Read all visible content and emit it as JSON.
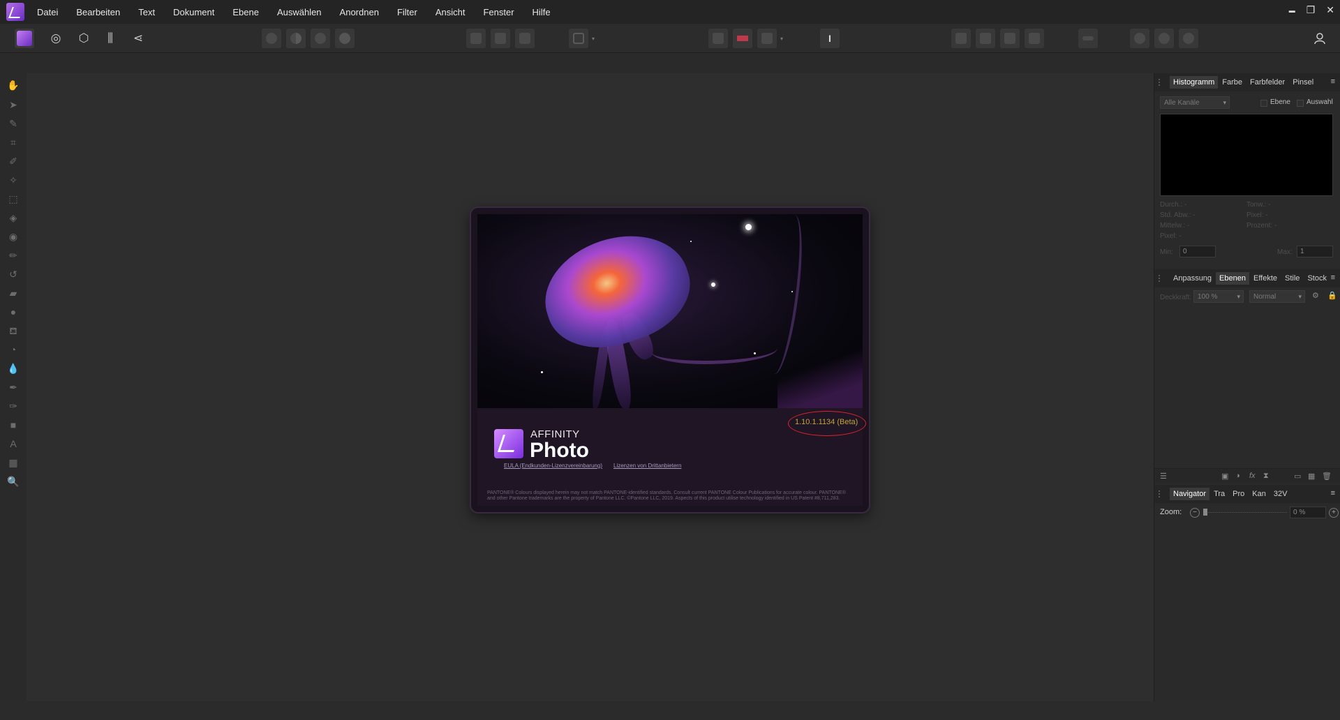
{
  "menu": {
    "items": [
      "Datei",
      "Bearbeiten",
      "Text",
      "Dokument",
      "Ebene",
      "Auswählen",
      "Anordnen",
      "Filter",
      "Ansicht",
      "Fenster",
      "Hilfe"
    ]
  },
  "window_controls": {
    "minimize": "▬",
    "restore": "❐",
    "close": "✕"
  },
  "splash": {
    "brand": "AFFINITY",
    "product": "Photo",
    "version": "1.10.1.1134 (Beta)",
    "eula_link": "EULA (Endkunden-Lizenzvereinbarung)",
    "third_party_link": "Lizenzen von Drittanbietern",
    "pantone_note": "PANTONE® Colours displayed herein may not match PANTONE-identified standards. Consult current PANTONE Colour Publications for accurate colour. PANTONE® and other Pantone trademarks are the property of Pantone LLC. ©Pantone LLC, 2019. Aspects of this product utilise technology identified in US Patent #8,711,283."
  },
  "histogram_panel": {
    "tabs": [
      "Histogramm",
      "Farbe",
      "Farbfelder",
      "Pinsel"
    ],
    "active_tab": "Histogramm",
    "channel_select": "Alle Kanäle",
    "layer_checkbox": "Ebene",
    "selection_checkbox": "Auswahl",
    "stats_left": [
      "Durch.: -",
      "Std. Abw.: -",
      "Mittelw.: -",
      "Pixel: -"
    ],
    "stats_right": [
      "Tonw.: -",
      "Pixel: -",
      "Prozent: -"
    ],
    "min_label": "Min:",
    "min_value": "0",
    "max_label": "Max:",
    "max_value": "1"
  },
  "layers_panel": {
    "tabs": [
      "Anpassung",
      "Ebenen",
      "Effekte",
      "Stile",
      "Stock"
    ],
    "active_tab": "Ebenen",
    "opacity_label": "Deckkraft:",
    "opacity_value": "100 %",
    "blend_mode": "Normal"
  },
  "navigator_panel": {
    "tabs": [
      "Navigator",
      "Tra",
      "Pro",
      "Kan",
      "32V"
    ],
    "active_tab": "Navigator",
    "zoom_label": "Zoom:",
    "zoom_value": "0 %"
  }
}
